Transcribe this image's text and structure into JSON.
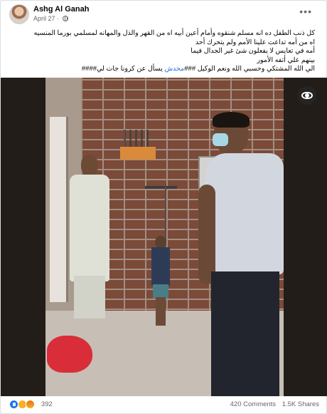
{
  "post": {
    "author": "Ashg Al Ganah",
    "date": "April 27",
    "date_separator": " · ",
    "more_label": "•••",
    "text_lines": [
      "كل ذنب الطفل ده انه مسلم شنقوه وأمام أعين أبيه اه من القهر والذل والمهانه لمسلمي بورما المنسيه",
      "اه من أمه تداعت علينا الأمم ولم يتحرك أحد",
      "أمه في تعايس لا يفعلون شئ غير الجدال فيما",
      "بينهم علي أتفه الأمور",
      "الي الله المشتكي وحسبي الله ونعم الوكيل ###محدش  يسأل عن كرونا جات لي####"
    ],
    "hashtag_word": "محدش"
  },
  "media": {
    "alt": "Photo of a child and two men in a brick room",
    "view_icon": "eye-icon"
  },
  "footer": {
    "reaction_icons": [
      "like-icon",
      "sad-icon",
      "angry-icon"
    ],
    "reaction_count": "392",
    "comments": "420 Comments",
    "shares": "1.5K Shares"
  },
  "colors": {
    "link": "#216fdb",
    "like_blue": "#1877f2",
    "secondary_text": "#65676b",
    "cloth_red": "#d92d3a"
  }
}
